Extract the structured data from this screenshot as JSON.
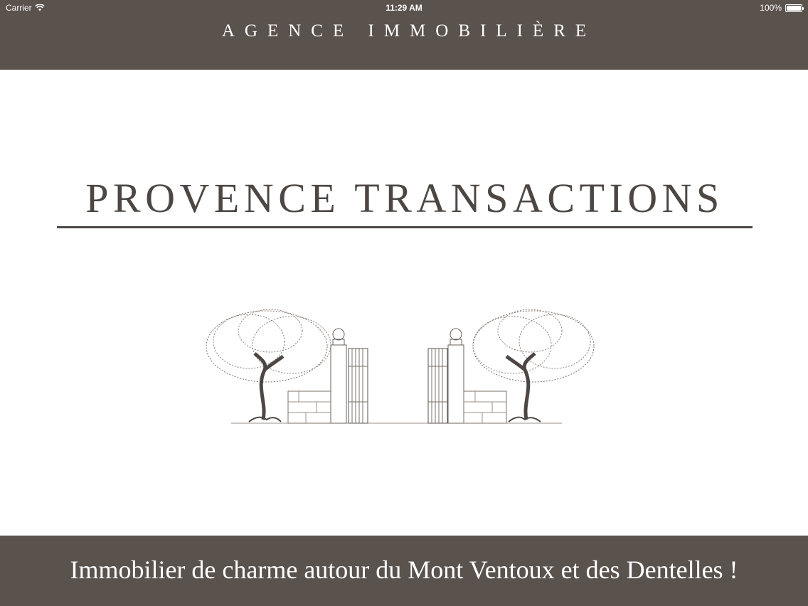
{
  "status_bar": {
    "carrier": "Carrier",
    "time": "11:29 AM",
    "battery_percent": "100%",
    "battery_level": 1.0
  },
  "header": {
    "title": "AGENCE IMMOBILIÈRE"
  },
  "logo": {
    "name": "PROVENCE TRANSACTIONS"
  },
  "footer": {
    "tagline": "Immobilier de charme autour du Mont Ventoux et des Dentelles !"
  },
  "colors": {
    "bar_background": "#5a524d",
    "logo_text": "#4d4744",
    "page_background": "#ffffff"
  }
}
